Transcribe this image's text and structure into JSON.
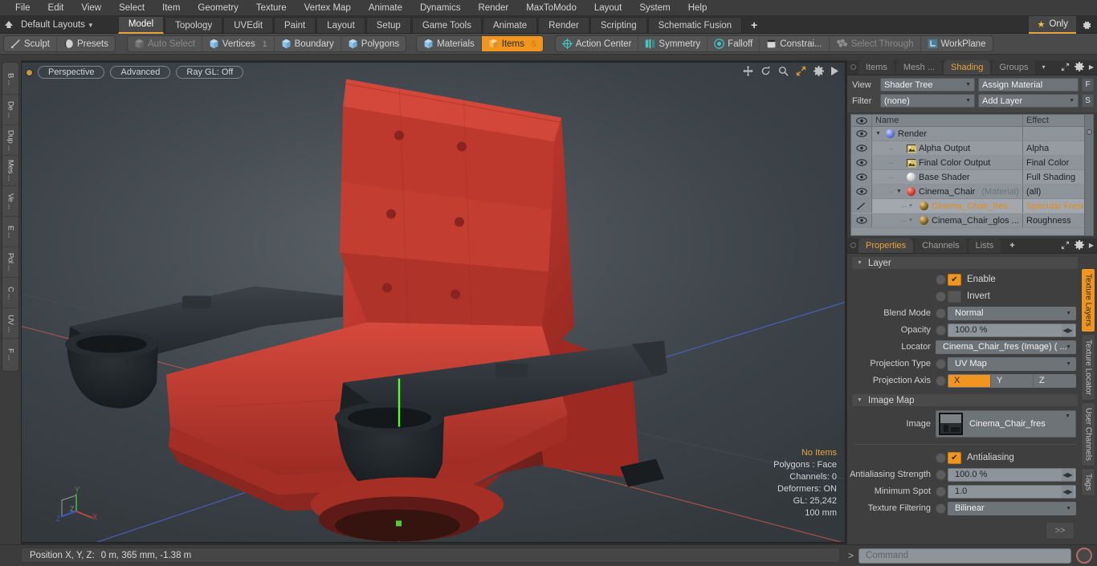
{
  "menu": {
    "items": [
      "File",
      "Edit",
      "View",
      "Select",
      "Item",
      "Geometry",
      "Texture",
      "Vertex Map",
      "Animate",
      "Dynamics",
      "Render",
      "MaxToModo",
      "Layout",
      "System",
      "Help"
    ]
  },
  "layoutbar": {
    "home_icon": "home-icon",
    "layout_label": "Default Layouts",
    "tabs": [
      {
        "label": "Model",
        "active": true
      },
      {
        "label": "Topology",
        "active": false
      },
      {
        "label": "UVEdit",
        "active": false
      },
      {
        "label": "Paint",
        "active": false
      },
      {
        "label": "Layout",
        "active": false
      },
      {
        "label": "Setup",
        "active": false
      },
      {
        "label": "Game Tools",
        "active": false
      },
      {
        "label": "Animate",
        "active": false
      },
      {
        "label": "Render",
        "active": false
      },
      {
        "label": "Scripting",
        "active": false
      },
      {
        "label": "Schematic Fusion",
        "active": false
      }
    ],
    "add_tab": "+",
    "only_label": "Only",
    "gear_icon": "gear-icon"
  },
  "modebar": {
    "group_left": [
      {
        "label": "Sculpt",
        "icon": "pencil-icon",
        "state": "normal"
      },
      {
        "label": "Presets",
        "icon": "sphere-icon",
        "state": "normal"
      }
    ],
    "group_select": [
      {
        "label": "Auto Select",
        "icon": "cube-icon",
        "state": "disabled",
        "count": ""
      },
      {
        "label": "Vertices",
        "icon": "cube-icon",
        "state": "normal",
        "count": "1"
      },
      {
        "label": "Boundary",
        "icon": "cube-icon",
        "state": "normal",
        "count": ""
      },
      {
        "label": "Polygons",
        "icon": "cube-icon",
        "state": "normal",
        "count": ""
      }
    ],
    "group_items": [
      {
        "label": "Materials",
        "icon": "cube-icon",
        "state": "normal",
        "count": ""
      },
      {
        "label": "Items",
        "icon": "cube-icon",
        "state": "active",
        "count": "5"
      }
    ],
    "group_tools": [
      {
        "label": "Action Center",
        "icon": "crosshair-icon",
        "state": "normal"
      },
      {
        "label": "Symmetry",
        "icon": "mirror-icon",
        "state": "normal"
      },
      {
        "label": "Falloff",
        "icon": "target-icon",
        "state": "normal"
      },
      {
        "label": "Constrai...",
        "icon": "square-icon",
        "state": "normal"
      },
      {
        "label": "Select Through",
        "icon": "select-through-icon",
        "state": "disabled"
      },
      {
        "label": "WorkPlane",
        "icon": "workplane-icon",
        "state": "normal"
      }
    ]
  },
  "leftrail": {
    "tabs": [
      "B ...",
      "De ...",
      "Dup ...",
      "Mes ...",
      "Ve ...",
      "E ...",
      "Pol ...",
      "C ...",
      "UV ...",
      "F ..."
    ]
  },
  "viewport": {
    "pills": [
      "Perspective",
      "Advanced",
      "Ray GL: Off"
    ],
    "icons": [
      "pan-icon",
      "rotate-icon",
      "zoom-icon",
      "fit-icon",
      "settings-icon",
      "play-icon"
    ],
    "stats": {
      "selection": "No Items",
      "polygons": "Polygons : Face",
      "channels": "Channels: 0",
      "deformers": "Deformers: ON",
      "gl": "GL: 25,242",
      "grid": "100 mm"
    },
    "axis": {
      "x": "X",
      "y": "Y",
      "z": "Z"
    },
    "colors": {
      "x_axis": "#c0453f",
      "y_axis": "#3f9e3f",
      "z_axis": "#3f57c0",
      "chair_red": "#c13a30",
      "arm_dark": "#2f3438"
    }
  },
  "rightpanel": {
    "top_tabs": [
      {
        "label": "Items",
        "active": false
      },
      {
        "label": "Mesh ...",
        "active": false
      },
      {
        "label": "Shading",
        "active": true
      },
      {
        "label": "Groups",
        "active": false
      }
    ],
    "top_tab_caret": "▾",
    "expand_icon": "expand-icon",
    "gear_icon": "gear-icon",
    "more_icon": "chevron-right-icon",
    "view_label": "View",
    "view_value": "Shader Tree",
    "assign_material": "Assign Material",
    "f_button": "F",
    "filter_label": "Filter",
    "filter_value": "(none)",
    "add_layer": "Add Layer",
    "s_button": "S",
    "tree_headers": {
      "eye": "eye-icon",
      "name": "Name",
      "effect": "Effect"
    },
    "tree_rows": [
      {
        "eye": true,
        "icon": "sphere-blue",
        "name": "Render",
        "suffix": "",
        "effect": "",
        "depth": 0,
        "expander": "▼",
        "selected": false,
        "orange": false
      },
      {
        "eye": true,
        "icon": "image",
        "name": "Alpha Output",
        "suffix": "",
        "effect": "Alpha",
        "depth": 1,
        "expander": "",
        "selected": false,
        "orange": false
      },
      {
        "eye": true,
        "icon": "image",
        "name": "Final Color Output",
        "suffix": "",
        "effect": "Final Color",
        "depth": 1,
        "expander": "",
        "selected": false,
        "orange": false
      },
      {
        "eye": true,
        "icon": "sphere-white",
        "name": "Base Shader",
        "suffix": "",
        "effect": "Full Shading",
        "depth": 1,
        "expander": "",
        "selected": false,
        "orange": false
      },
      {
        "eye": true,
        "icon": "sphere-red",
        "name": "Cinema_Chair",
        "suffix": "(Material)",
        "effect": "(all)",
        "depth": 1,
        "expander": "▼",
        "selected": false,
        "orange": false
      },
      {
        "eye": false,
        "icon": "sphere-gold",
        "name": "Cinema_Chair_fres ...",
        "suffix": "",
        "effect": "Specular Fresn...",
        "depth": 2,
        "expander": "+",
        "selected": true,
        "orange": true
      },
      {
        "eye": true,
        "icon": "sphere-gold",
        "name": "Cinema_Chair_glos ...",
        "suffix": "",
        "effect": "Roughness",
        "depth": 2,
        "expander": "+",
        "selected": false,
        "orange": false
      }
    ],
    "prop_tabs": [
      {
        "label": "Properties",
        "active": true
      },
      {
        "label": "Channels",
        "active": false
      },
      {
        "label": "Lists",
        "active": false
      }
    ],
    "prop_add": "+",
    "layer_section": {
      "title": "Layer",
      "enable_label": "Enable",
      "enable_checked": true,
      "invert_label": "Invert",
      "invert_checked": false,
      "blend_mode_label": "Blend Mode",
      "blend_mode_value": "Normal",
      "opacity_label": "Opacity",
      "opacity_value": "100.0 %",
      "locator_label": "Locator",
      "locator_value": "Cinema_Chair_fres (Image) ( ...",
      "projection_type_label": "Projection Type",
      "projection_type_value": "UV Map",
      "projection_axis_label": "Projection Axis",
      "projection_axis": [
        {
          "label": "X",
          "on": true
        },
        {
          "label": "Y",
          "on": false
        },
        {
          "label": "Z",
          "on": false
        }
      ]
    },
    "image_map_section": {
      "title": "Image Map",
      "image_label": "Image",
      "image_value": "Cinema_Chair_fres",
      "antialiasing_label": "Antialiasing",
      "antialiasing_checked": true,
      "aa_strength_label": "Antialiasing Strength",
      "aa_strength_value": "100.0 %",
      "min_spot_label": "Minimum Spot",
      "min_spot_value": "1.0",
      "texture_filtering_label": "Texture Filtering",
      "texture_filtering_value": "Bilinear",
      "more_button": ">>"
    },
    "vertical_tabs": [
      {
        "label": "Texture Layers",
        "active": true
      },
      {
        "label": "Texture Locator",
        "active": false
      },
      {
        "label": "User Channels",
        "active": false
      },
      {
        "label": "Tags",
        "active": false
      }
    ]
  },
  "bottombar": {
    "position_label": "Position X, Y, Z:",
    "position_value": "0 m, 365 mm, -1.38 m",
    "command_prompt": ">",
    "command_placeholder": "Command",
    "record_icon": "record-icon"
  },
  "colors": {
    "accent": "#f0951f",
    "accent_text": "#e8a33d",
    "panel_bg": "#3c3c3c",
    "field_bg": "#8d949a"
  }
}
